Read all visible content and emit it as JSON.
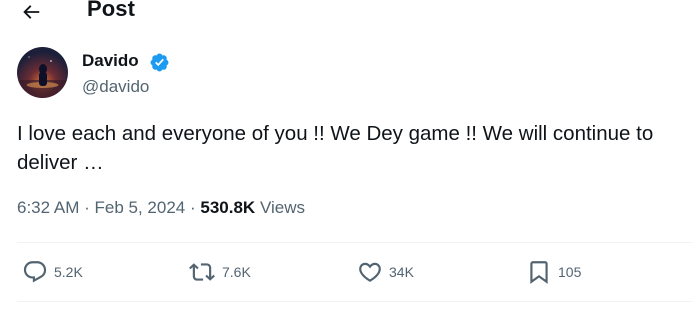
{
  "header": {
    "title": "Post"
  },
  "author": {
    "name": "Davido",
    "handle": "@davido",
    "verified": true
  },
  "post": {
    "text": "I love each and everyone of you !! We Dey game !! We will continue to deliver …",
    "time": "6:32 AM",
    "date": "Feb 5, 2024",
    "views_count": "530.8K",
    "views_label": "Views"
  },
  "actions": {
    "replies": "5.2K",
    "reposts": "7.6K",
    "likes": "34K",
    "bookmarks": "105"
  },
  "colors": {
    "text": "#0f1419",
    "secondary": "#536471",
    "verified": "#1d9bf0",
    "divider": "#eff3f4"
  }
}
